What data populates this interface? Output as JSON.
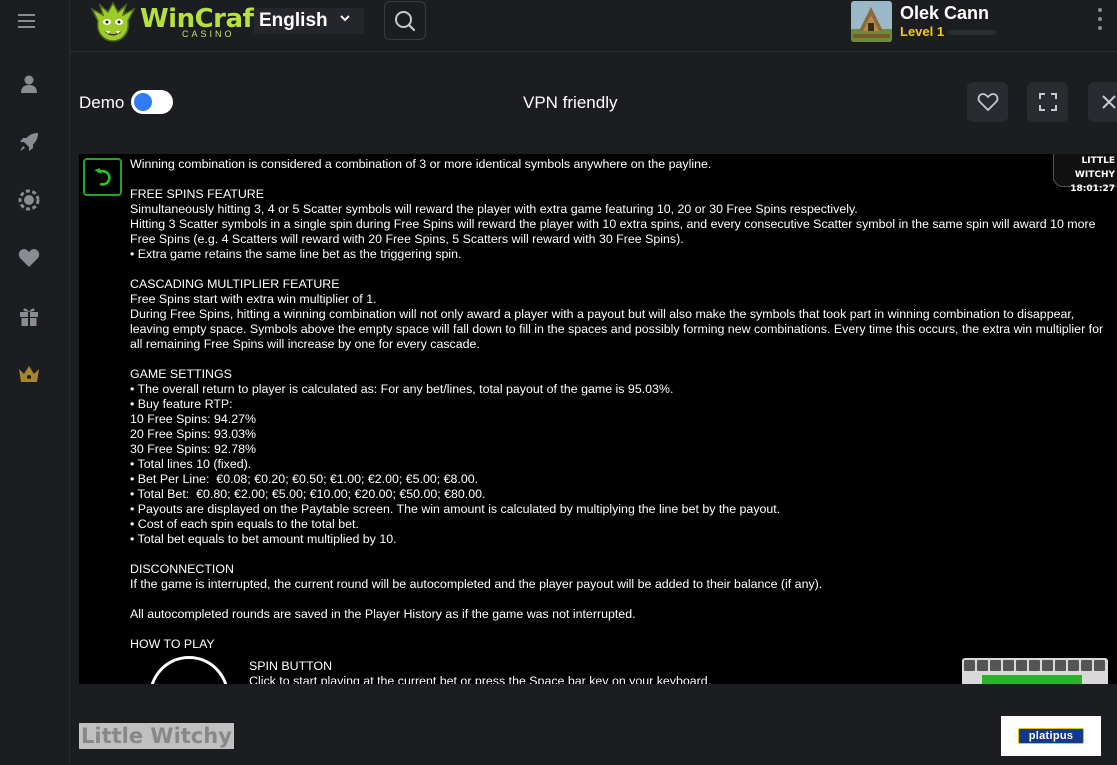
{
  "header": {
    "brand_name": "WinCraft",
    "brand_sub": "CASINO",
    "language": "English",
    "user_name": "Olek Cann",
    "user_level": "Level 1"
  },
  "sidebar": {
    "items": [
      {
        "name": "menu-icon"
      },
      {
        "name": "profile-icon"
      },
      {
        "name": "rocket-icon"
      },
      {
        "name": "chip-icon"
      },
      {
        "name": "heart-icon"
      },
      {
        "name": "gift-icon"
      },
      {
        "name": "crown-icon"
      }
    ]
  },
  "toolbar": {
    "demo_label": "Demo",
    "demo_enabled": true,
    "vpn_label": "VPN friendly"
  },
  "game": {
    "badge_title": "LITTLE WITCHY",
    "badge_time": "18:01:27",
    "rules": {
      "intro": "Winning combination is considered a combination of 3 or more identical symbols anywhere on the payline.",
      "free_spins_title": "FREE SPINS FEATURE",
      "free_spins_1": "Simultaneously hitting 3, 4 or 5 Scatter symbols will reward the player with extra game featuring 10, 20 or 30 Free Spins respectively.",
      "free_spins_2": "Hitting 3 Scatter symbols in a single spin during Free Spins will reward the player with 10 extra spins, and every consecutive Scatter symbol in the same spin will award 10 more Free Spins (e.g. 4 Scatters will reward with 20 Free Spins, 5 Scatters will reward with 30 Free Spins).",
      "free_spins_3": "• Extra game retains the same line bet as the triggering spin.",
      "cascading_title": "CASCADING MULTIPLIER FEATURE",
      "cascading_1": "Free Spins start with extra win multiplier of 1.",
      "cascading_2": "During Free Spins, hitting a winning combination will not only award a player with a payout but will also make the symbols that took part in winning combination to disappear, leaving empty space. Symbols above the empty space will fall down to fill in the spaces and possibly forming new combinations. Every time this occurs, the extra win multiplier for all remaining Free Spins will increase by one for every cascade.",
      "settings_title": "GAME SETTINGS",
      "settings_lines": [
        "• The overall return to player is calculated as: For any bet/lines, total payout of the game is 95.03%.",
        "• Buy feature RTP:",
        "10 Free Spins: 94.27%",
        "20 Free Spins: 93.03%",
        "30 Free Spins: 92.78%",
        "• Total lines 10 (fixed).",
        "• Bet Per Line:  €0.08; €0.20; €0.50; €1.00; €2.00; €5.00; €8.00.",
        "• Total Bet:  €0.80; €2.00; €5.00; €10.00; €20.00; €50.00; €80.00.",
        "• Payouts are displayed on the Paytable screen. The win amount is calculated by multiplying the line bet by the payout.",
        "• Cost of each spin equals to the total bet.",
        "• Total bet equals to bet amount multiplied by 10."
      ],
      "disconnection_title": "DISCONNECTION",
      "disconnection_1": "If the game is interrupted, the current round will be autocompleted and the player payout will be added to their balance (if any).",
      "disconnection_2": "All autocompleted rounds are saved in the Player History as if the game was not interrupted.",
      "how_to_play_title": "HOW TO PLAY",
      "spin_button_title": "SPIN BUTTON",
      "spin_button_desc": "Click to start playing at the current bet or press the Space bar key on your keyboard."
    }
  },
  "footer": {
    "game_title": "Little Witchy",
    "provider": "platipus"
  },
  "colors": {
    "background": "#1c1d21",
    "accent_green": "#b7e03a",
    "level_yellow": "#f4c620",
    "toggle_blue": "#2f7cf6"
  }
}
